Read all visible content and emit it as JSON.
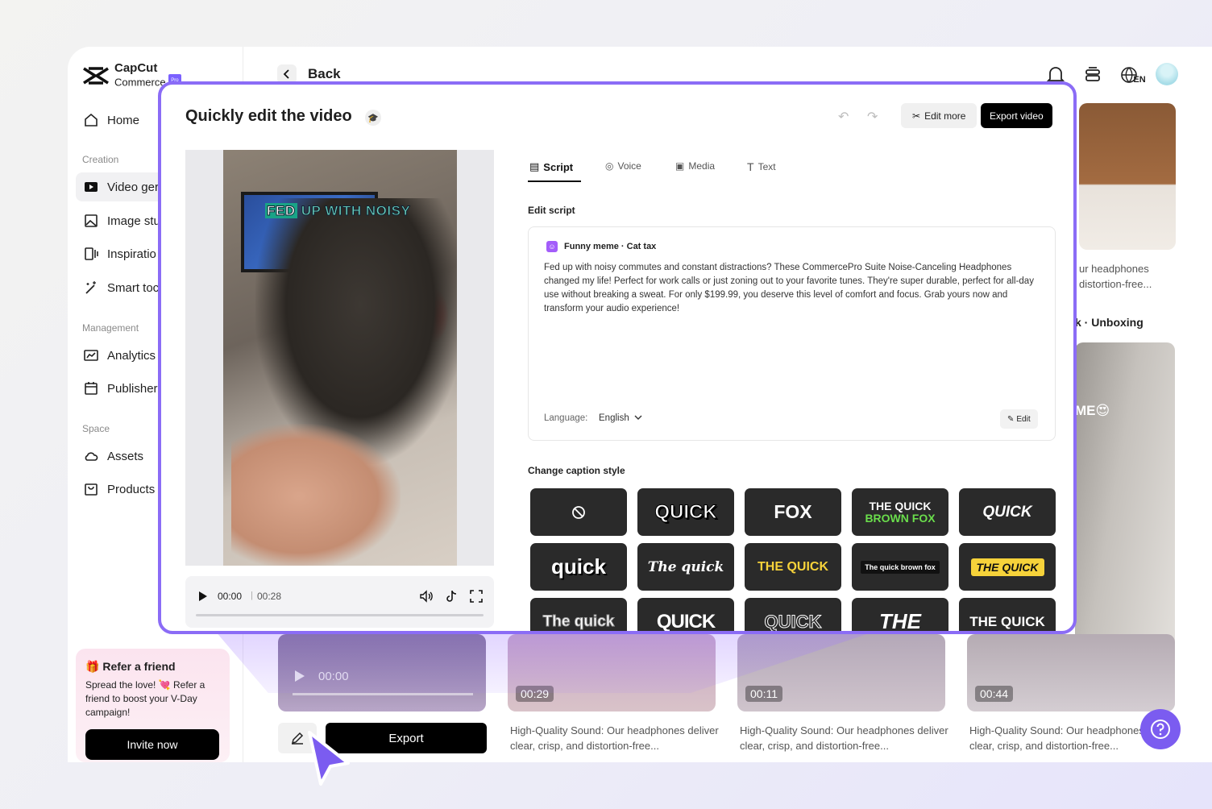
{
  "brand": {
    "name_line1": "CapCut",
    "name_line2": "Commerce",
    "badge": "Pro"
  },
  "sidebar": {
    "items": [
      {
        "label": "Home",
        "icon": "home-icon"
      },
      {
        "label": "Video ger",
        "icon": "video-icon"
      },
      {
        "label": "Image stu",
        "icon": "image-icon"
      },
      {
        "label": "Inspiratio",
        "icon": "inspiration-icon"
      },
      {
        "label": "Smart toc",
        "icon": "magic-wand-icon"
      },
      {
        "label": "Analytics",
        "icon": "analytics-icon"
      },
      {
        "label": "Publisher",
        "icon": "calendar-icon"
      },
      {
        "label": "Assets",
        "icon": "cloud-icon"
      },
      {
        "label": "Products",
        "icon": "bag-icon"
      }
    ],
    "sections": {
      "creation": "Creation",
      "management": "Management",
      "space": "Space"
    },
    "refer": {
      "title": "Refer a friend",
      "body": "Spread the love! 💘 Refer a friend to boost your V-Day campaign!",
      "button": "Invite now"
    }
  },
  "header": {
    "back_label": "Back",
    "lang": "EN"
  },
  "background": {
    "card_captions": [
      "ur headphones",
      "distortion-free...",
      "k · Unboxing"
    ],
    "card_overlay_text": "ME😍",
    "player_time": "00:00",
    "durations": [
      "00:29",
      "00:11",
      "00:44"
    ],
    "bottom_captions": [
      "High-Quality Sound: Our headphones deliver clear, crisp, and distortion-free...",
      "High-Quality Sound: Our headphones deliver clear, crisp, and distortion-free...",
      "High-Quality Sound: Our headphones deliver clear, crisp, and distortion-free..."
    ],
    "export_label": "Export"
  },
  "modal": {
    "title": "Quickly edit the video",
    "edit_more": "Edit more",
    "export_video": "Export video",
    "video_caption_highlight": "FED",
    "video_caption_rest": " UP WITH NOISY",
    "player": {
      "current": "00:00",
      "separator": "|",
      "total": "00:28",
      "progress": 0
    },
    "tabs": [
      {
        "label": "Script",
        "active": true
      },
      {
        "label": "Voice",
        "active": false
      },
      {
        "label": "Media",
        "active": false
      },
      {
        "label": "Text",
        "active": false
      }
    ],
    "edit_script_label": "Edit script",
    "script": {
      "heading": "Funny meme · Cat tax",
      "text": "Fed up with noisy commutes and constant distractions? These CommercePro Suite Noise-Canceling Headphones changed my life! Perfect for work calls or just zoning out to your favorite tunes. They're super durable, perfect for all-day use without breaking a sweat. For only $199.99, you deserve this level of comfort and focus. Grab yours now and transform your audio experience!",
      "language_label": "Language:",
      "language_value": "English",
      "edit_label": "Edit"
    },
    "caption_style_label": "Change caption style",
    "caption_styles": [
      "",
      "QUICK",
      "FOX",
      "THE QUICK BROWN FOX",
      "QUICK",
      "quick",
      "The quick",
      "THE QUICK",
      "The quick brown fox",
      "THE QUICK",
      "The quick",
      "QUICK",
      "QUICK",
      "THE",
      "THE QUICK"
    ]
  },
  "colors": {
    "accent": "#8b6cf6",
    "help_button": "#7b5cf0",
    "primary_button": "#000000"
  }
}
